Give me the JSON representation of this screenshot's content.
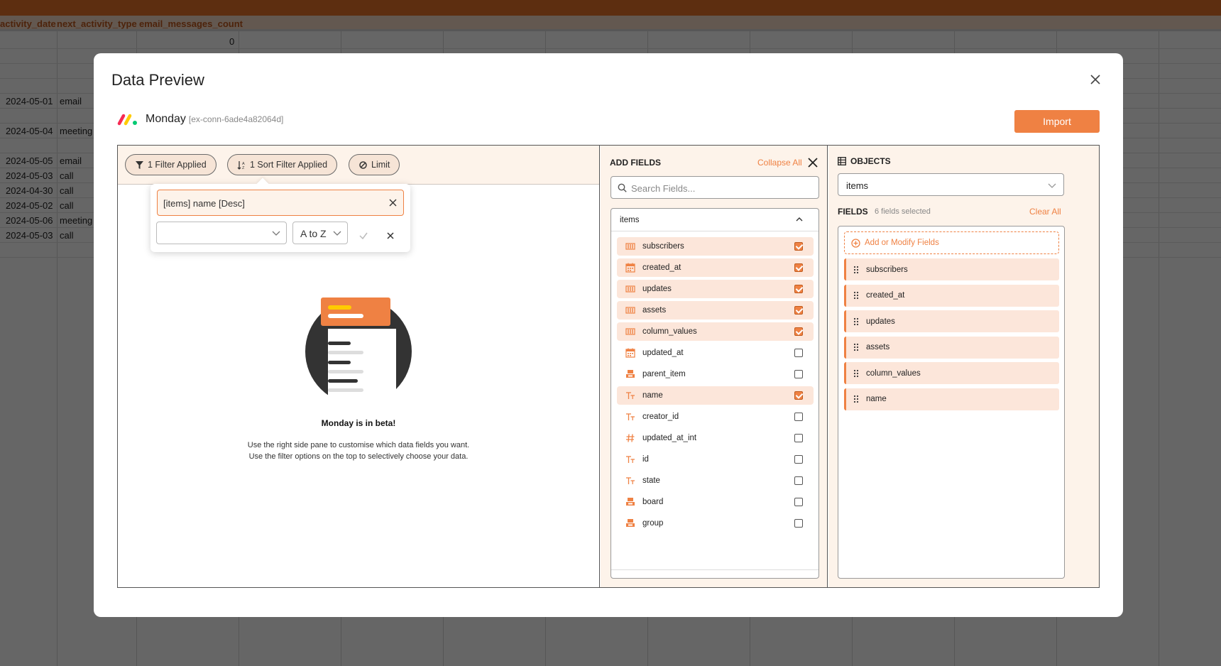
{
  "background_sheet": {
    "columns": [
      "activity_date",
      "next_activity_type",
      "email_messages_count"
    ],
    "first_row_count": "0",
    "rows": [
      {
        "date": "2024-05-01",
        "type": "email"
      },
      {
        "date": "2024-05-04",
        "type": "meeting"
      },
      {
        "date": "2024-05-05",
        "type": "email"
      },
      {
        "date": "2024-05-03",
        "type": "call"
      },
      {
        "date": "2024-04-30",
        "type": "call"
      },
      {
        "date": "2024-05-02",
        "type": "call"
      },
      {
        "date": "2024-05-06",
        "type": "meeting"
      },
      {
        "date": "2024-05-03",
        "type": "call"
      }
    ]
  },
  "modal": {
    "title": "Data Preview",
    "connection_name": "Monday",
    "connection_id": "[ex-conn-6ade4a82064d]",
    "import_label": "Import"
  },
  "preview": {
    "filter_pill": "1 Filter Applied",
    "sort_pill": "1 Sort Filter Applied",
    "limit_pill": "Limit",
    "sort_popover": {
      "chip_label": "[items] name [Desc]",
      "field_select_value": "",
      "order_select_value": "A to Z"
    },
    "beta_title": "Monday is in beta!",
    "beta_line1": "Use the right side pane to customise which data fields you want.",
    "beta_line2": "Use the filter options on the top to selectively choose your data."
  },
  "add_fields": {
    "title": "ADD FIELDS",
    "collapse_all": "Collapse All",
    "search_placeholder": "Search Fields...",
    "group_name": "items",
    "fields": [
      {
        "label": "subscribers",
        "icon": "list-icon",
        "checked": true
      },
      {
        "label": "created_at",
        "icon": "calendar-icon",
        "checked": true
      },
      {
        "label": "updates",
        "icon": "list-icon",
        "checked": true
      },
      {
        "label": "assets",
        "icon": "list-icon",
        "checked": true
      },
      {
        "label": "column_values",
        "icon": "list-icon",
        "checked": true
      },
      {
        "label": "updated_at",
        "icon": "calendar-icon",
        "checked": false
      },
      {
        "label": "parent_item",
        "icon": "object-icon",
        "checked": false
      },
      {
        "label": "name",
        "icon": "text-icon",
        "checked": true
      },
      {
        "label": "creator_id",
        "icon": "text-icon",
        "checked": false
      },
      {
        "label": "updated_at_int",
        "icon": "hash-icon",
        "checked": false
      },
      {
        "label": "id",
        "icon": "text-icon",
        "checked": false
      },
      {
        "label": "state",
        "icon": "text-icon",
        "checked": false
      },
      {
        "label": "board",
        "icon": "object-icon",
        "checked": false
      },
      {
        "label": "group",
        "icon": "object-icon",
        "checked": false
      }
    ]
  },
  "objects": {
    "title": "OBJECTS",
    "selected_object": "items",
    "fields_header": "FIELDS",
    "fields_count": "6 fields selected",
    "clear_all": "Clear All",
    "add_modify": "Add or Modify Fields",
    "selected_fields": [
      "subscribers",
      "created_at",
      "updates",
      "assets",
      "column_values",
      "name"
    ]
  },
  "colors": {
    "accent": "#ef8143",
    "accent_light": "#fce6da",
    "pane_bg": "#fdf3ea"
  }
}
